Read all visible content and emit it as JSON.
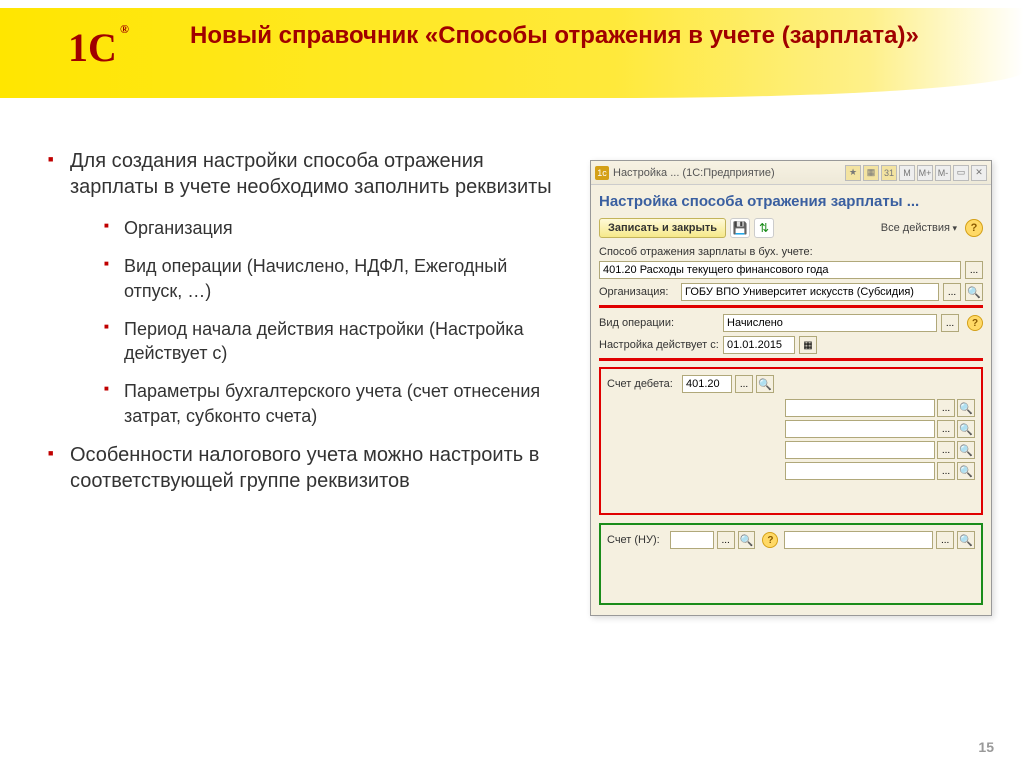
{
  "slide": {
    "title": "Новый справочник «Способы отражения в учете (зарплата)»",
    "page": "15",
    "logo": "1С",
    "bullets": {
      "b1": "Для создания настройки способа отражения зарплаты в учете необходимо заполнить реквизиты",
      "sub1": "Организация",
      "sub2": "Вид операции (Начислено, НДФЛ, Ежегодный отпуск, …)",
      "sub3": "Период начала действия настройки (Настройка действует с)",
      "sub4": "Параметры бухгалтерского учета (счет отнесения затрат, субконто счета)",
      "b2": "Особенности налогового учета можно настроить в соответствующей группе реквизитов"
    }
  },
  "app": {
    "title": "Настройка ...  (1С:Предприятие)",
    "formTitle": "Настройка способа отражения зарплаты ...",
    "btnSave": "Записать и закрыть",
    "allActions": "Все действия",
    "lblMethod": "Способ отражения зарплаты в бух. учете:",
    "valMethod": "401.20 Расходы текущего финансового года",
    "lblOrg": "Организация:",
    "valOrg": "ГОБУ ВПО Университет искусств (Субсидия)",
    "lblOpType": "Вид операции:",
    "valOpType": "Начислено",
    "lblDateFrom": "Настройка действует с:",
    "valDateFrom": "01.01.2015",
    "lblDebit": "Счет дебета:",
    "valDebit": "401.20",
    "lblTax": "Счет (НУ):",
    "ellipsis": "...",
    "tbM": "M",
    "tbMplus": "M+",
    "tbMminus": "M-",
    "tbMin": "▭",
    "tbClose": "✕"
  }
}
